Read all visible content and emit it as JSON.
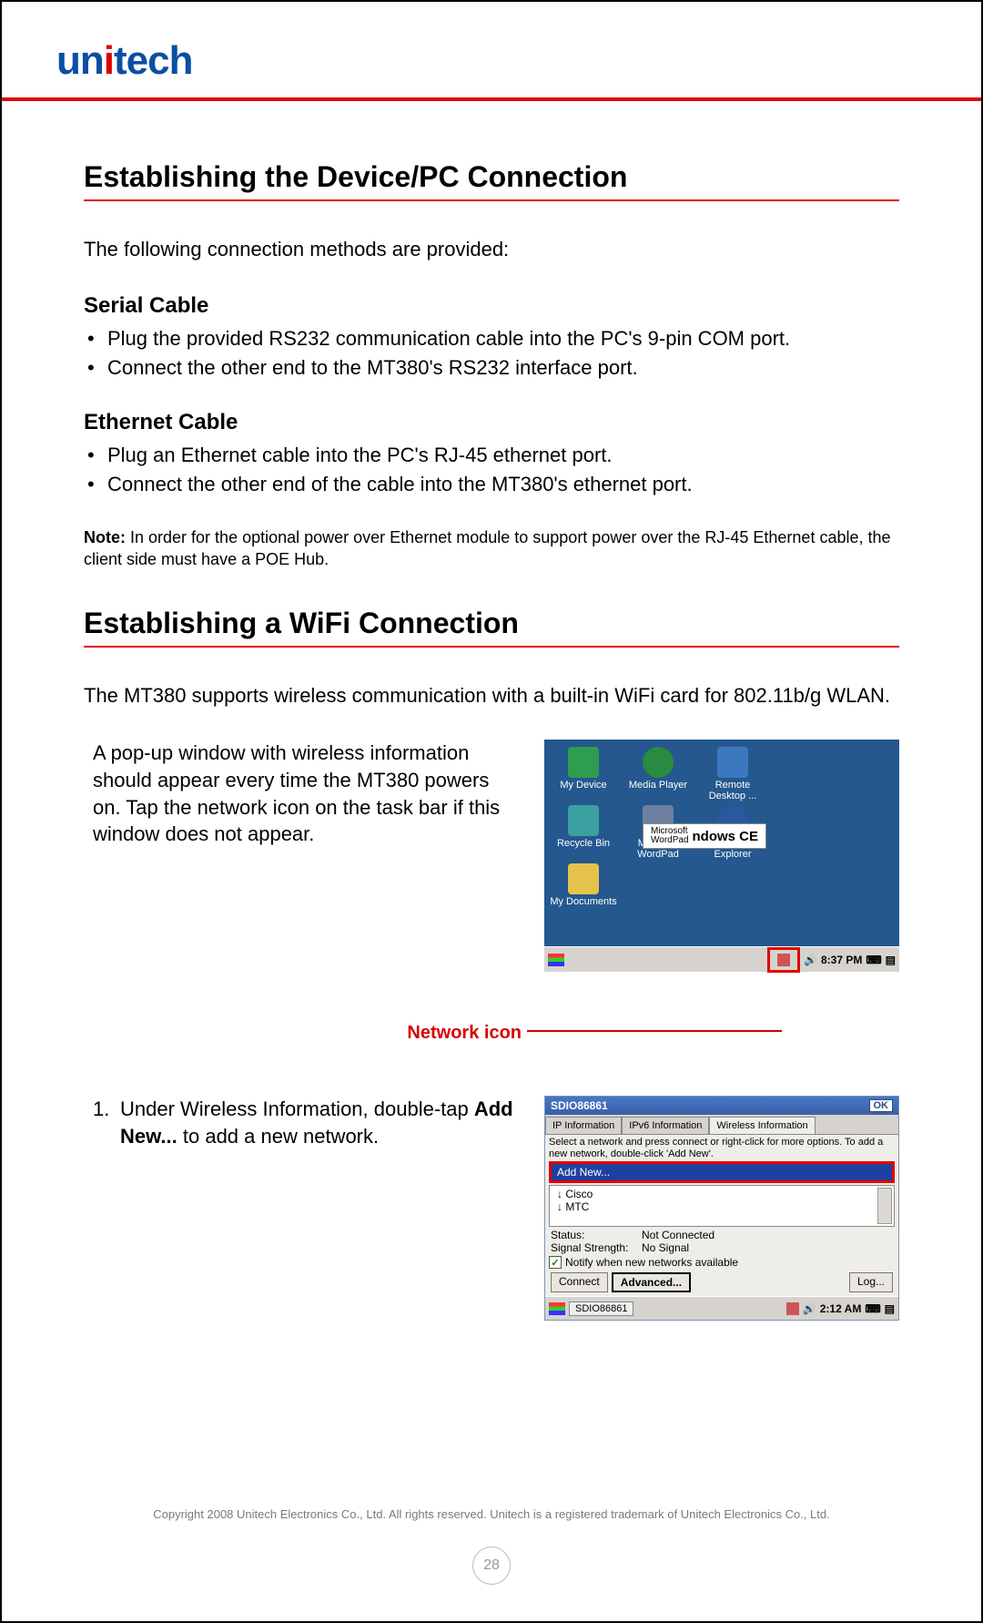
{
  "header": {
    "logo_prefix": "un",
    "logo_dot": "i",
    "logo_suffix": "tech"
  },
  "section1": {
    "title": "Establishing the Device/PC Connection",
    "intro": "The following connection methods are provided:",
    "serial": {
      "heading": "Serial Cable",
      "items": [
        "Plug the provided RS232 communication cable into the PC's 9-pin COM port.",
        "Connect the other end to the MT380's RS232 interface port."
      ]
    },
    "ethernet": {
      "heading": "Ethernet Cable",
      "items": [
        "Plug an Ethernet cable into the PC's RJ-45 ethernet port.",
        "Connect the other end of the cable into the MT380's ethernet port."
      ]
    },
    "note_label": "Note:",
    "note_text": "In order for the optional power over Ethernet module to support power over the RJ-45 Ethernet cable, the client side must have a POE Hub."
  },
  "section2": {
    "title": "Establishing a WiFi Connection",
    "intro": "The MT380 supports wireless communication with a built-in WiFi card for 802.11b/g WLAN.",
    "step0_text": "A pop-up window with wireless information should appear every time the MT380 powers on. Tap the network icon on the task bar if this window does not appear.",
    "network_icon_label": "Network icon",
    "step1_num": "1.",
    "step1_before": "Under Wireless Information, double-tap ",
    "step1_bold": "Add New...",
    "step1_after": " to add a new network."
  },
  "shot1": {
    "icons": [
      "My Device",
      "Media Player",
      "Remote Desktop ...",
      "Recycle Bin",
      "Microsoft WordPad",
      "Internet Explorer",
      "My Documents"
    ],
    "ce_small_top": "Microsoft",
    "ce_small_bottom": "WordPad",
    "ce_big": "ndows CE",
    "time": "8:37 PM"
  },
  "shot2": {
    "title": "SDIO86861",
    "ok": "OK",
    "tabs": [
      "IP Information",
      "IPv6 Information",
      "Wireless Information"
    ],
    "hint": "Select a network and press connect or right-click for more options.  To add a new network, double-click 'Add New'.",
    "add_new": "Add New...",
    "nets": [
      "Cisco",
      "MTC"
    ],
    "status_lbl": "Status:",
    "status_val": "Not Connected",
    "signal_lbl": "Signal Strength:",
    "signal_val": "No Signal",
    "notify": "Notify when new networks available",
    "connect": "Connect",
    "advanced": "Advanced...",
    "log": "Log...",
    "task": "SDIO86861",
    "time": "2:12 AM"
  },
  "footer": {
    "copyright": "Copyright 2008 Unitech Electronics Co., Ltd. All rights reserved. Unitech is a registered trademark of Unitech Electronics Co., Ltd.",
    "page": "28"
  }
}
